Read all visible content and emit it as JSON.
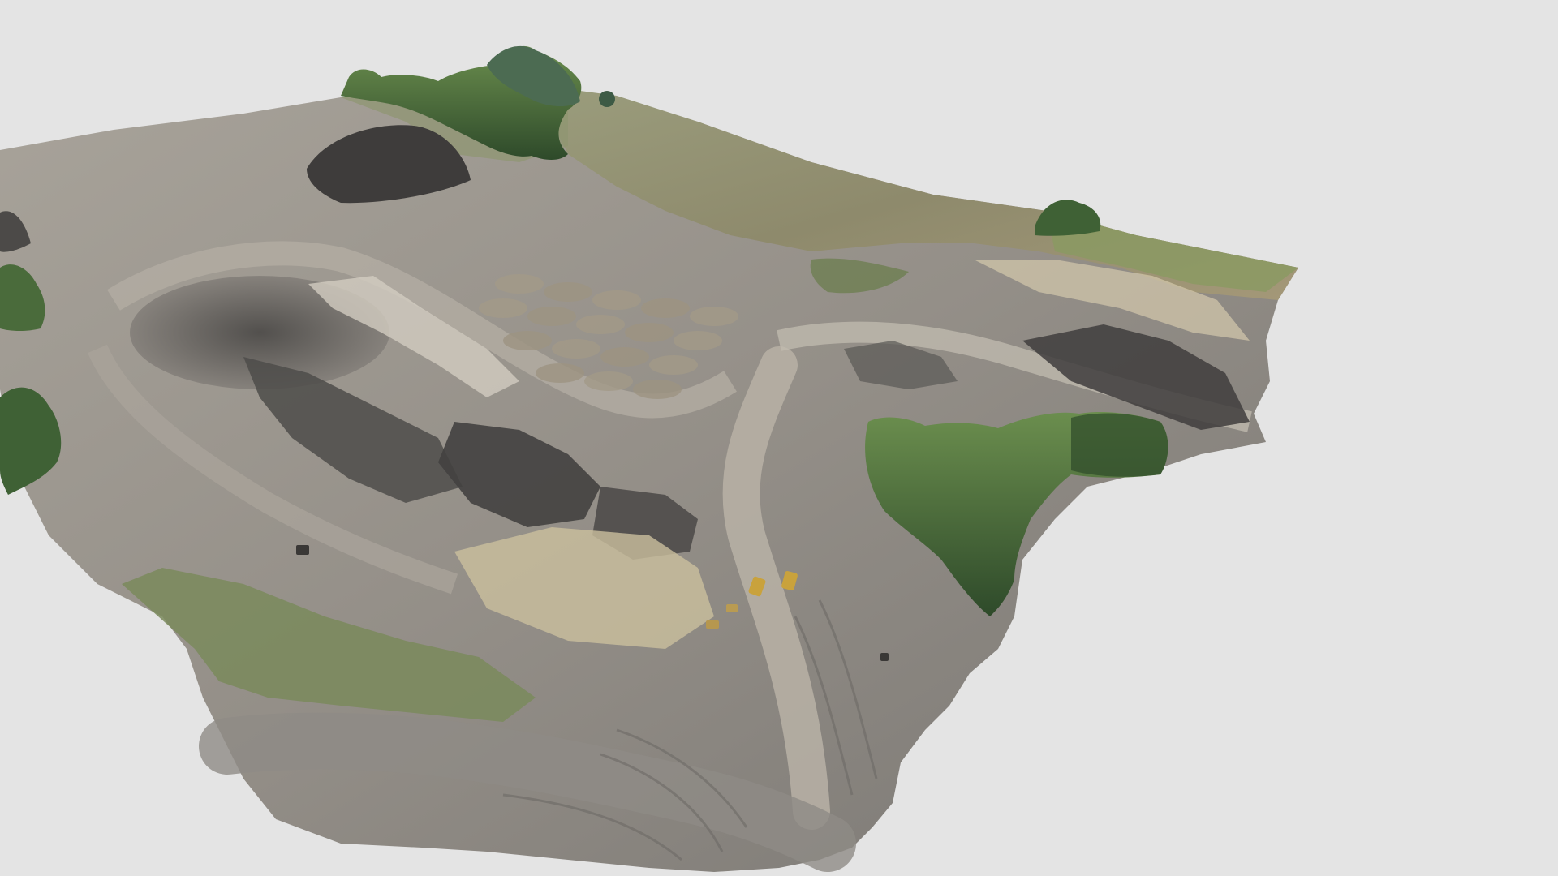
{
  "scene": {
    "subject": "photogrammetry-terrain-model",
    "background_color": "#e4e4e4",
    "palette": {
      "gravel_light": "#bdb7ab",
      "gravel_mid": "#8f8a82",
      "gravel_dark": "#5d5a57",
      "coal_black": "#3c3a3a",
      "sand": "#cbbf9e",
      "grass": "#7d8a5a",
      "meadow": "#a29a78",
      "tree_green": "#4f6e3c",
      "tree_dark": "#2f4a2a",
      "truck_yellow": "#c9a23c"
    }
  }
}
